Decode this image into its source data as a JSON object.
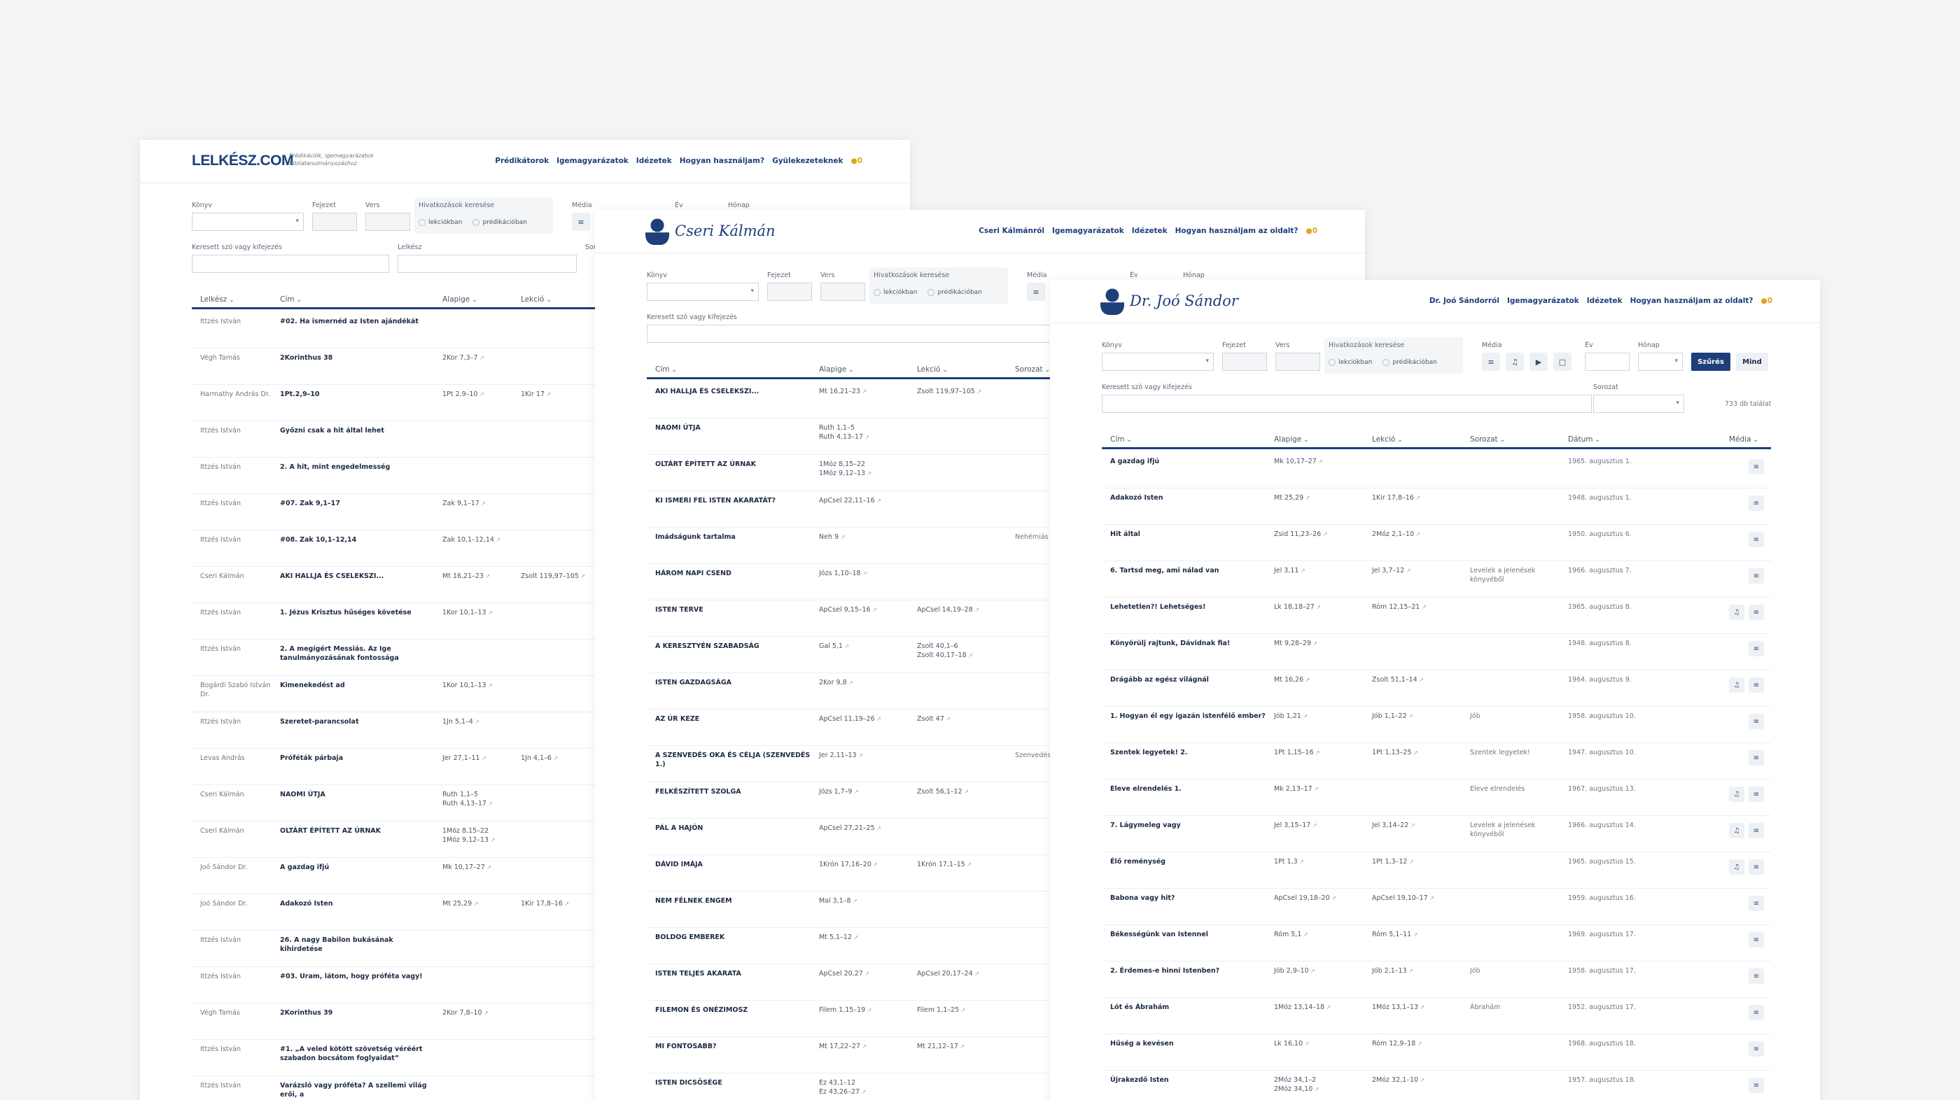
{
  "w1": {
    "logo": "LELKÉSZ.COM",
    "tagline": "Prédikációk, igemagyarázatok bibliatanulmányozáshoz",
    "nav": [
      "Prédikátorok",
      "Igemagyarázatok",
      "Idézetek",
      "Hogyan használjam?",
      "Gyülekezeteknek"
    ],
    "coin": "0",
    "f": {
      "konyv": "Könyv",
      "fejezet": "Fejezet",
      "vers": "Vers",
      "hiv": "Hivatkozások keresése",
      "lek": "lekciókban",
      "pred": "prédikációban",
      "media": "Média",
      "ev": "Év",
      "honap": "Hónap",
      "kereset": "Keresett szó vagy kifejezés",
      "lelkesz": "Lelkész",
      "sor": "Sor"
    },
    "cols": [
      "Lelkész",
      "Cím",
      "Alapige",
      "Lekció"
    ],
    "rows": [
      [
        "Ittzés István",
        "#02. Ha ismernéd az Isten ajándékát",
        "",
        ""
      ],
      [
        "Végh Tamás",
        "2Korinthus 38",
        "2Kor 7,3–7",
        ""
      ],
      [
        "Harmathy András Dr.",
        "1Pt.2,9–10",
        "1Pt 2,9–10",
        "1Kir 17"
      ],
      [
        "Ittzés István",
        "Győzni csak a hit által lehet",
        "",
        ""
      ],
      [
        "Ittzés István",
        "2. A hit, mint engedelmesség",
        "",
        ""
      ],
      [
        "Ittzés István",
        "#07. Zak 9,1–17",
        "Zak 9,1–17",
        ""
      ],
      [
        "Ittzés István",
        "#08. Zak 10,1–12,14",
        "Zak 10,1–12,14",
        ""
      ],
      [
        "Cseri Kálmán",
        "AKI HALLJA ÉS CSELEKSZI...",
        "Mt 16,21–23",
        "Zsolt 119,97–105"
      ],
      [
        "Ittzés István",
        "1. Jézus Krisztus hűséges követése",
        "1Kor 10,1–13",
        ""
      ],
      [
        "Ittzés István",
        "2. A megígért Messiás. Az Ige tanulmányozásának fontossága",
        "",
        ""
      ],
      [
        "Bogárdi Szabó István Dr.",
        "Kimenekedést ad",
        "1Kor 10,1–13",
        ""
      ],
      [
        "Ittzés István",
        "Szeretet-parancsolat",
        "1Jn 5,1–4",
        ""
      ],
      [
        "Levas András",
        "Próféták párbaja",
        "Jer 27,1–11",
        "1Jn 4,1–6"
      ],
      [
        "Cseri Kálmán",
        "NAOMI ÚTJA",
        "Ruth 1,1–5\nRuth 4,13–17",
        ""
      ],
      [
        "Cseri Kálmán",
        "OLTÁRT ÉPÍTETT AZ ÚRNAK",
        "1Móz 8,15–22\n1Móz 9,12–13",
        ""
      ],
      [
        "Joó Sándor Dr.",
        "A gazdag ifjú",
        "Mk 10,17–27",
        ""
      ],
      [
        "Joó Sándor Dr.",
        "Adakozó Isten",
        "Mt 25,29",
        "1Kir 17,8–16"
      ],
      [
        "Ittzés István",
        "26. A nagy Babilon bukásának kihirdetése",
        "",
        ""
      ],
      [
        "Ittzés István",
        "#03. Uram, látom, hogy próféta vagy!",
        "",
        ""
      ],
      [
        "Végh Tamás",
        "2Korinthus 39",
        "2Kor 7,8–10",
        ""
      ],
      [
        "Ittzés István",
        "#1. „A veled kötött szövetség véréért szabadon bocsátom foglyaidat”",
        "",
        ""
      ],
      [
        "Ittzés István",
        "Varázsló vagy próféta? A szellemi világ erői, a",
        "",
        ""
      ]
    ]
  },
  "w2": {
    "logo": "Cseri Kálmán",
    "nav": [
      "Cseri Kálmánról",
      "Igemagyarázatok",
      "Idézetek",
      "Hogyan használjam az oldalt?"
    ],
    "coin": "0",
    "f": {
      "konyv": "Könyv",
      "fejezet": "Fejezet",
      "vers": "Vers",
      "hiv": "Hivatkozások keresése",
      "lek": "lekciókban",
      "pred": "prédikációban",
      "media": "Média",
      "ev": "Év",
      "honap": "Hónap",
      "kereset": "Keresett szó vagy kifejezés"
    },
    "cols": [
      "Cím",
      "Alapige",
      "Lekció",
      "Sorozat"
    ],
    "rows": [
      [
        "AKI HALLJA ÉS CSELEKSZI...",
        "Mt 16,21–23",
        "Zsolt 119,97–105",
        ""
      ],
      [
        "NAOMI ÚTJA",
        "Ruth 1,1–5\nRuth 4,13–17",
        "",
        ""
      ],
      [
        "OLTÁRT ÉPÍTETT AZ ÚRNAK",
        "1Móz 8,15–22\n1Móz 9,12–13",
        "",
        ""
      ],
      [
        "KI ISMERI FEL ISTEN AKARATÁT?",
        "ApCsel 22,11–16",
        "",
        ""
      ],
      [
        "Imádságunk tartalma",
        "Neh 9",
        "",
        "Nehémiás"
      ],
      [
        "HÁROM NAPI CSEND",
        "Józs 1,10–18",
        "",
        ""
      ],
      [
        "ISTEN TERVE",
        "ApCsel 9,15–16",
        "ApCsel 14,19–28",
        ""
      ],
      [
        "A KERESZTYÉN SZABADSÁG",
        "Gal 5,1",
        "Zsolt 40,1–6\nZsolt 40,17–18",
        ""
      ],
      [
        "ISTEN GAZDAGSÁGA",
        "2Kor 9,8",
        "",
        ""
      ],
      [
        "AZ ÚR KEZE",
        "ApCsel 11,19–26",
        "Zsolt 47",
        ""
      ],
      [
        "A SZENVEDÉS OKA ÉS CÉLJA (SZENVEDÉS 1.)",
        "Jer 2,11–13",
        "",
        "Szenvedés"
      ],
      [
        "FELKÉSZÍTETT SZOLGA",
        "Józs 1,7–9",
        "Zsolt 56,1–12",
        ""
      ],
      [
        "PÁL A HAJÓN",
        "ApCsel 27,21–25",
        "",
        ""
      ],
      [
        "DÁVID IMÁJA",
        "1Krón 17,16–20",
        "1Krón 17,1–15",
        ""
      ],
      [
        "NEM FÉLNEK ENGEM",
        "Mal 3,1–8",
        "",
        ""
      ],
      [
        "BOLDOG EMBEREK",
        "Mt 5,1–12",
        "",
        ""
      ],
      [
        "ISTEN TELJES AKARATA",
        "ApCsel 20,27",
        "ApCsel 20,17–24",
        ""
      ],
      [
        "FILEMON ÉS ONÉZIMOSZ",
        "Filem 1,15–19",
        "Filem 1,1–25",
        ""
      ],
      [
        "MI FONTOSABB?",
        "Mt 17,22–27",
        "Mt 21,12–17",
        ""
      ],
      [
        "ISTEN DICSŐSÉGE",
        "Ez 43,1–12\nEz 43,26–27",
        "",
        ""
      ]
    ]
  },
  "w3": {
    "logo": "Dr. Joó Sándor",
    "nav": [
      "Dr. Joó Sándorról",
      "Igemagyarázatok",
      "Idézetek",
      "Hogyan használjam az oldalt?"
    ],
    "coin": "0",
    "f": {
      "konyv": "Könyv",
      "fejezet": "Fejezet",
      "vers": "Vers",
      "hiv": "Hivatkozások keresése",
      "lek": "lekciókban",
      "pred": "prédikációban",
      "media": "Média",
      "ev": "Év",
      "honap": "Hónap",
      "kereset": "Keresett szó vagy kifejezés",
      "sorozat": "Sorozat",
      "szures": "Szűrés",
      "mind": "Mind",
      "talalat": "733 db találat"
    },
    "cols": [
      "Cím",
      "Alapige",
      "Lekció",
      "Sorozat",
      "Dátum",
      "Média"
    ],
    "rows": [
      [
        "A gazdag ifjú",
        "Mk 10,17–27",
        "",
        "",
        "1965. augusztus 1.",
        "t"
      ],
      [
        "Adakozó Isten",
        "Mt 25,29",
        "1Kir 17,8–16",
        "",
        "1948. augusztus 1.",
        "t"
      ],
      [
        "Hit által",
        "Zsid 11,23–26",
        "2Móz 2,1–10",
        "",
        "1950. augusztus 6.",
        "t"
      ],
      [
        "6. Tartsd meg, ami nálad van",
        "Jel 3,11",
        "Jel 3,7–12",
        "Levelek a jelenések könyvéből",
        "1966. augusztus 7.",
        "t"
      ],
      [
        "Lehetetlen?! Lehetséges!",
        "Lk 18,18–27",
        "Róm 12,15–21",
        "",
        "1965. augusztus 8.",
        "at"
      ],
      [
        "Könyörülj rajtunk, Dávidnak fia!",
        "Mt 9,28–29",
        "",
        "",
        "1948. augusztus 8.",
        "t"
      ],
      [
        "Drágább az egész világnál",
        "Mt 16,26",
        "Zsolt 51,1–14",
        "",
        "1964. augusztus 9.",
        "at"
      ],
      [
        "1. Hogyan él egy igazán istenfélő ember?",
        "Jób 1,21",
        "Jób 1,1–22",
        "Jób",
        "1958. augusztus 10.",
        "t"
      ],
      [
        "Szentek legyetek! 2.",
        "1Pt 1,15–16",
        "1Pt 1,13–25",
        "Szentek legyetek!",
        "1947. augusztus 10.",
        "t"
      ],
      [
        "Eleve elrendelés 1.",
        "Mk 2,13–17",
        "",
        "Eleve elrendelés",
        "1967. augusztus 13.",
        "at"
      ],
      [
        "7. Lágymeleg vagy",
        "Jel 3,15–17",
        "Jel 3,14–22",
        "Levelek a jelenések könyvéből",
        "1966. augusztus 14.",
        "at"
      ],
      [
        "Élő reménység",
        "1Pt 1,3",
        "1Pt 1,3–12",
        "",
        "1965. augusztus 15.",
        "at"
      ],
      [
        "Babona vagy hit?",
        "ApCsel 19,18–20",
        "ApCsel 19,10–17",
        "",
        "1959. augusztus 16.",
        "t"
      ],
      [
        "Békességünk van Istennel",
        "Róm 5,1",
        "Róm 5,1–11",
        "",
        "1969. augusztus 17.",
        "t"
      ],
      [
        "2. Érdemes-e hinni Istenben?",
        "Jób 2,9–10",
        "Jób 2,1–13",
        "Jób",
        "1958. augusztus 17.",
        "t"
      ],
      [
        "Lót és Ábrahám",
        "1Móz 13,14–18",
        "1Móz 13,1–13",
        "Ábrahám",
        "1952. augusztus 17.",
        "t"
      ],
      [
        "Hűség a kevésen",
        "Lk 16,10",
        "Róm 12,9–18",
        "",
        "1968. augusztus 18.",
        "t"
      ],
      [
        "Újrakezdő Isten",
        "2Móz 34,1–2\n2Móz 34,10",
        "2Móz 32,1–10",
        "",
        "1957. augusztus 18.",
        "t"
      ]
    ]
  }
}
